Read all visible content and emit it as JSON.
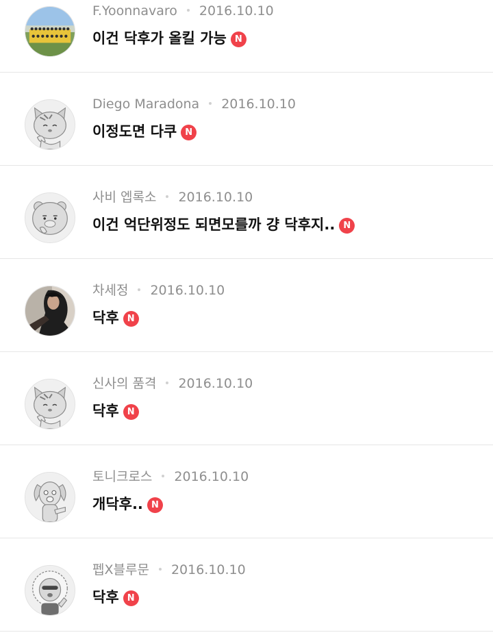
{
  "badge_label": "N",
  "colors": {
    "badge": "#f0424a",
    "meta": "#8e8e8e",
    "divider": "#e6e6e6"
  },
  "posts": [
    {
      "author": "F.Yoonnavaro",
      "date": "2016.10.10",
      "title": "이건 닥후가 올킬 가능",
      "avatar": "team-photo-avatar"
    },
    {
      "author": "Diego Maradona",
      "date": "2016.10.10",
      "title": "이정도면 다쿠",
      "avatar": "cat-character-avatar"
    },
    {
      "author": "사비 엡록소",
      "date": "2016.10.10",
      "title": "이건 억단위정도 되면모를까 걍 닥후지..",
      "avatar": "bear-character-avatar"
    },
    {
      "author": "차세정",
      "date": "2016.10.10",
      "title": "닥후",
      "avatar": "person-photo-avatar"
    },
    {
      "author": "신사의 품격",
      "date": "2016.10.10",
      "title": "닥후",
      "avatar": "cat-character-avatar"
    },
    {
      "author": "토니크로스",
      "date": "2016.10.10",
      "title": "개닥후..",
      "avatar": "dog-character-avatar"
    },
    {
      "author": "펩X블루문",
      "date": "2016.10.10",
      "title": "닥후",
      "avatar": "lion-character-avatar"
    }
  ]
}
